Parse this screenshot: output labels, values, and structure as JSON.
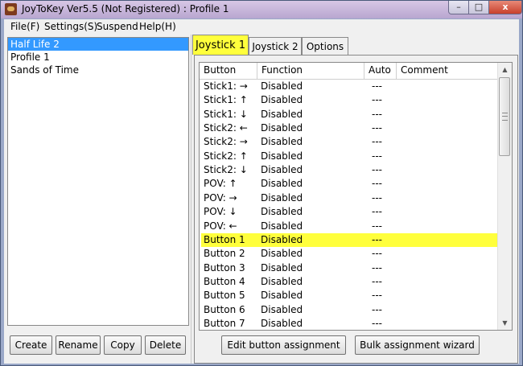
{
  "window": {
    "title": "JoyToKey Ver5.5 (Not Registered) : Profile 1",
    "close_glyph": "x"
  },
  "menu": [
    "File(F)",
    "Settings(S)",
    "Suspend",
    "Help(H)"
  ],
  "profiles": [
    "Half Life 2",
    "Profile 1",
    "Sands of Time"
  ],
  "profile_buttons": {
    "create": "Create",
    "rename": "Rename",
    "copy": "Copy",
    "delete": "Delete"
  },
  "tabs": [
    "Joystick 1",
    "Joystick 2",
    "Options"
  ],
  "grid": {
    "headers": [
      "Button",
      "Function",
      "Auto",
      "Comment"
    ],
    "rows": [
      {
        "button": "Stick1: →",
        "function": "Disabled",
        "auto": "---",
        "comment": ""
      },
      {
        "button": "Stick1: ↑",
        "function": "Disabled",
        "auto": "---",
        "comment": ""
      },
      {
        "button": "Stick1: ↓",
        "function": "Disabled",
        "auto": "---",
        "comment": ""
      },
      {
        "button": "Stick2: ←",
        "function": "Disabled",
        "auto": "---",
        "comment": ""
      },
      {
        "button": "Stick2: →",
        "function": "Disabled",
        "auto": "---",
        "comment": ""
      },
      {
        "button": "Stick2: ↑",
        "function": "Disabled",
        "auto": "---",
        "comment": ""
      },
      {
        "button": "Stick2: ↓",
        "function": "Disabled",
        "auto": "---",
        "comment": ""
      },
      {
        "button": "POV: ↑",
        "function": "Disabled",
        "auto": "---",
        "comment": ""
      },
      {
        "button": "POV: →",
        "function": "Disabled",
        "auto": "---",
        "comment": ""
      },
      {
        "button": "POV: ↓",
        "function": "Disabled",
        "auto": "---",
        "comment": ""
      },
      {
        "button": "POV: ←",
        "function": "Disabled",
        "auto": "---",
        "comment": ""
      },
      {
        "button": "Button 1",
        "function": "Disabled",
        "auto": "---",
        "comment": ""
      },
      {
        "button": "Button 2",
        "function": "Disabled",
        "auto": "---",
        "comment": ""
      },
      {
        "button": "Button 3",
        "function": "Disabled",
        "auto": "---",
        "comment": ""
      },
      {
        "button": "Button 4",
        "function": "Disabled",
        "auto": "---",
        "comment": ""
      },
      {
        "button": "Button 5",
        "function": "Disabled",
        "auto": "---",
        "comment": ""
      },
      {
        "button": "Button 6",
        "function": "Disabled",
        "auto": "---",
        "comment": ""
      },
      {
        "button": "Button 7",
        "function": "Disabled",
        "auto": "---",
        "comment": ""
      }
    ]
  },
  "action_buttons": {
    "edit": "Edit button assignment",
    "bulk": "Bulk assignment wizard"
  },
  "colors": {
    "highlight": "#ffff3c",
    "selection": "#3399ff"
  }
}
